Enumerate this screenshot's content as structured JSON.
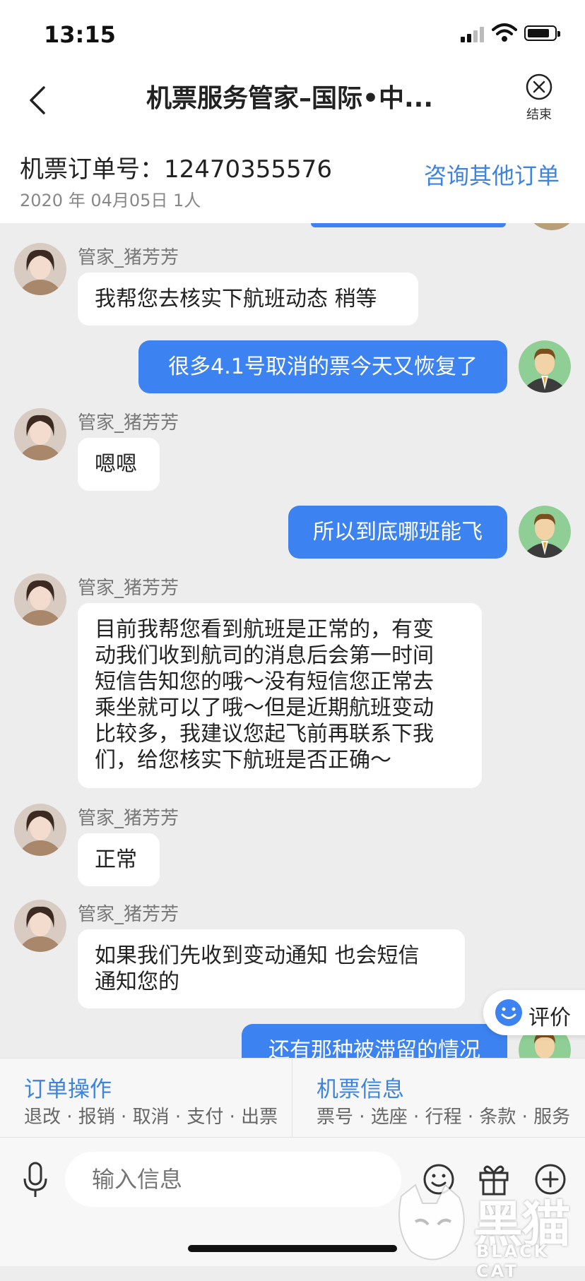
{
  "status_bar": {
    "time": "13:15"
  },
  "nav": {
    "title": "机票服务管家–国际•中...",
    "end_label": "结束"
  },
  "order": {
    "number": "机票订单号：12470355576",
    "date": "2020 年 04月05日 1人",
    "consult_label": "咨询其他订单"
  },
  "messages": [
    {
      "side": "in",
      "sender": "管家_猪芳芳",
      "text": "我帮您去核实下航班动态 稍等"
    },
    {
      "side": "out",
      "text": "很多4.1号取消的票今天又恢复了"
    },
    {
      "side": "in",
      "sender": "管家_猪芳芳",
      "text": "嗯嗯"
    },
    {
      "side": "out",
      "text": "所以到底哪班能飞"
    },
    {
      "side": "in",
      "sender": "管家_猪芳芳",
      "lines": [
        "目前我帮您看到航班是正常的，有变",
        "动我们收到航司的消息后会第一时间",
        "短信告知您的哦～没有短信您正常去",
        "乘坐就可以了哦～但是近期航班变动",
        "比较多，我建议您起飞前再联系下我",
        "们，给您核实下航班是否正确～"
      ]
    },
    {
      "side": "in",
      "sender": "管家_猪芳芳",
      "text": "正常"
    },
    {
      "side": "in",
      "sender": "管家_猪芳芳",
      "lines": [
        "如果我们先收到变动通知 也会短信",
        "通知您的"
      ]
    },
    {
      "side": "out",
      "text": "还有那种被滞留的情况"
    }
  ],
  "rate_button": {
    "label": "评价"
  },
  "panels": [
    {
      "title": "订单操作",
      "items": "退改 · 报销 · 取消 · 支付 · 出票"
    },
    {
      "title": "机票信息",
      "items": "票号 · 选座 · 行程 · 条款 · 服务"
    }
  ],
  "input": {
    "placeholder": "输入信息"
  },
  "watermark": {
    "logo": "黑猫",
    "sub": "BLACK CAT"
  },
  "colors": {
    "accent": "#3d84e0",
    "bubble_out": "#3c82f0",
    "background": "#ededed"
  }
}
